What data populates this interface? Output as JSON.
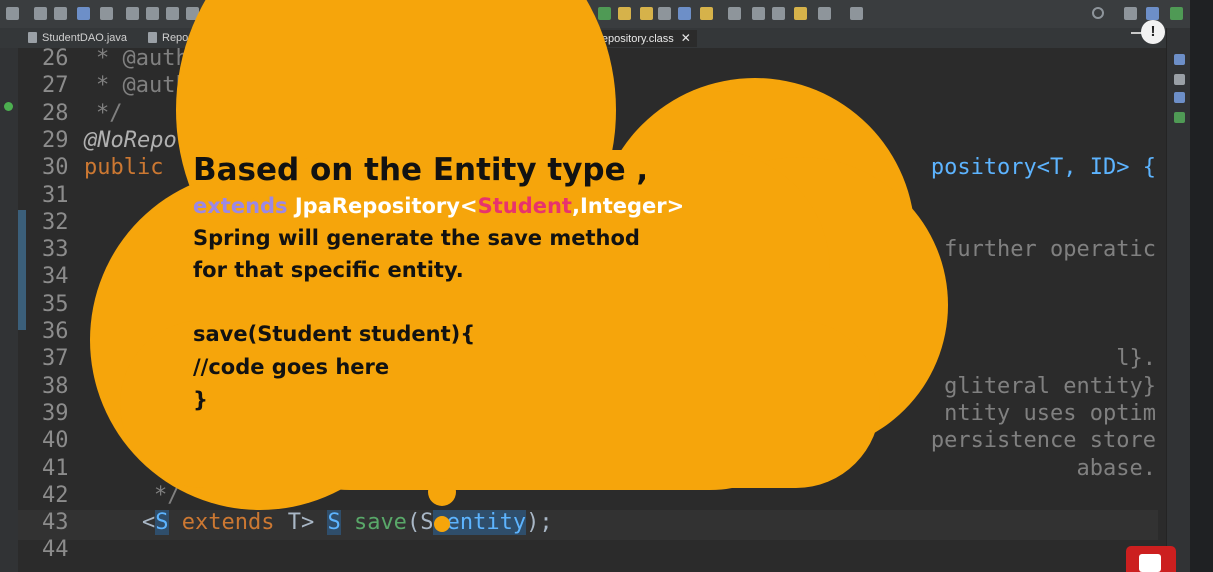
{
  "tabs": [
    {
      "label": "StudentDAO.java",
      "active": false
    },
    {
      "label": "Repository.cl",
      "active": false
    },
    {
      "label": "rudRepository.class",
      "active": true
    }
  ],
  "code_lines": [
    {
      "num": "26",
      "text": "* @autho"
    },
    {
      "num": "27",
      "text": "* @auth"
    },
    {
      "num": "28",
      "text": "*/"
    },
    {
      "num": "29",
      "text": "@NoRepo"
    },
    {
      "num": "30",
      "text": "public",
      "right": "pository<T, ID> {"
    },
    {
      "num": "31",
      "text": ""
    },
    {
      "num": "32",
      "text": "/"
    },
    {
      "num": "33",
      "text": "",
      "right": "further operatic"
    },
    {
      "num": "34",
      "text": ""
    },
    {
      "num": "35",
      "text": ""
    },
    {
      "num": "36",
      "text": ""
    },
    {
      "num": "37",
      "text": "",
      "right": "l}."
    },
    {
      "num": "38",
      "text": "",
      "right": "gliteral entity}"
    },
    {
      "num": "39",
      "text": "",
      "right": "ntity uses optim"
    },
    {
      "num": "40",
      "text": "",
      "right": "persistence store"
    },
    {
      "num": "41",
      "text": "*",
      "right": "abase."
    },
    {
      "num": "42",
      "text": "*/"
    },
    {
      "num": "43",
      "text": "<S extends T> S save(S entity);"
    },
    {
      "num": "44",
      "text": ""
    }
  ],
  "cloud": {
    "title": "Based on the Entity type ,",
    "extends_kw": "extends",
    "jpa_open": " JpaRepository<",
    "student": "Student",
    "jpa_close": ",Integer>",
    "line3": "Spring will generate the save method",
    "line4": "for that specific entity.",
    "line5": "save(Student student){",
    "line6": "//code goes here",
    "line7": "}"
  },
  "colors": {
    "cloud": "#f6a50b",
    "extends_kw": "#9b88e6",
    "student": "#e8336d",
    "jpa_text": "#ffffff",
    "keyword": "#cc7832",
    "annotation": "#bbb529",
    "comment": "#808080",
    "type_param": "#5db4ff",
    "method": "#59a869",
    "youtube": "#cc1f1f"
  },
  "icons": [
    "new-file-icon",
    "save-icon",
    "save-all-icon",
    "debug-icon",
    "run-icon",
    "pause-icon",
    "stop-icon",
    "search-icon",
    "pin-icon",
    "info-icon",
    "youtube-icon"
  ]
}
